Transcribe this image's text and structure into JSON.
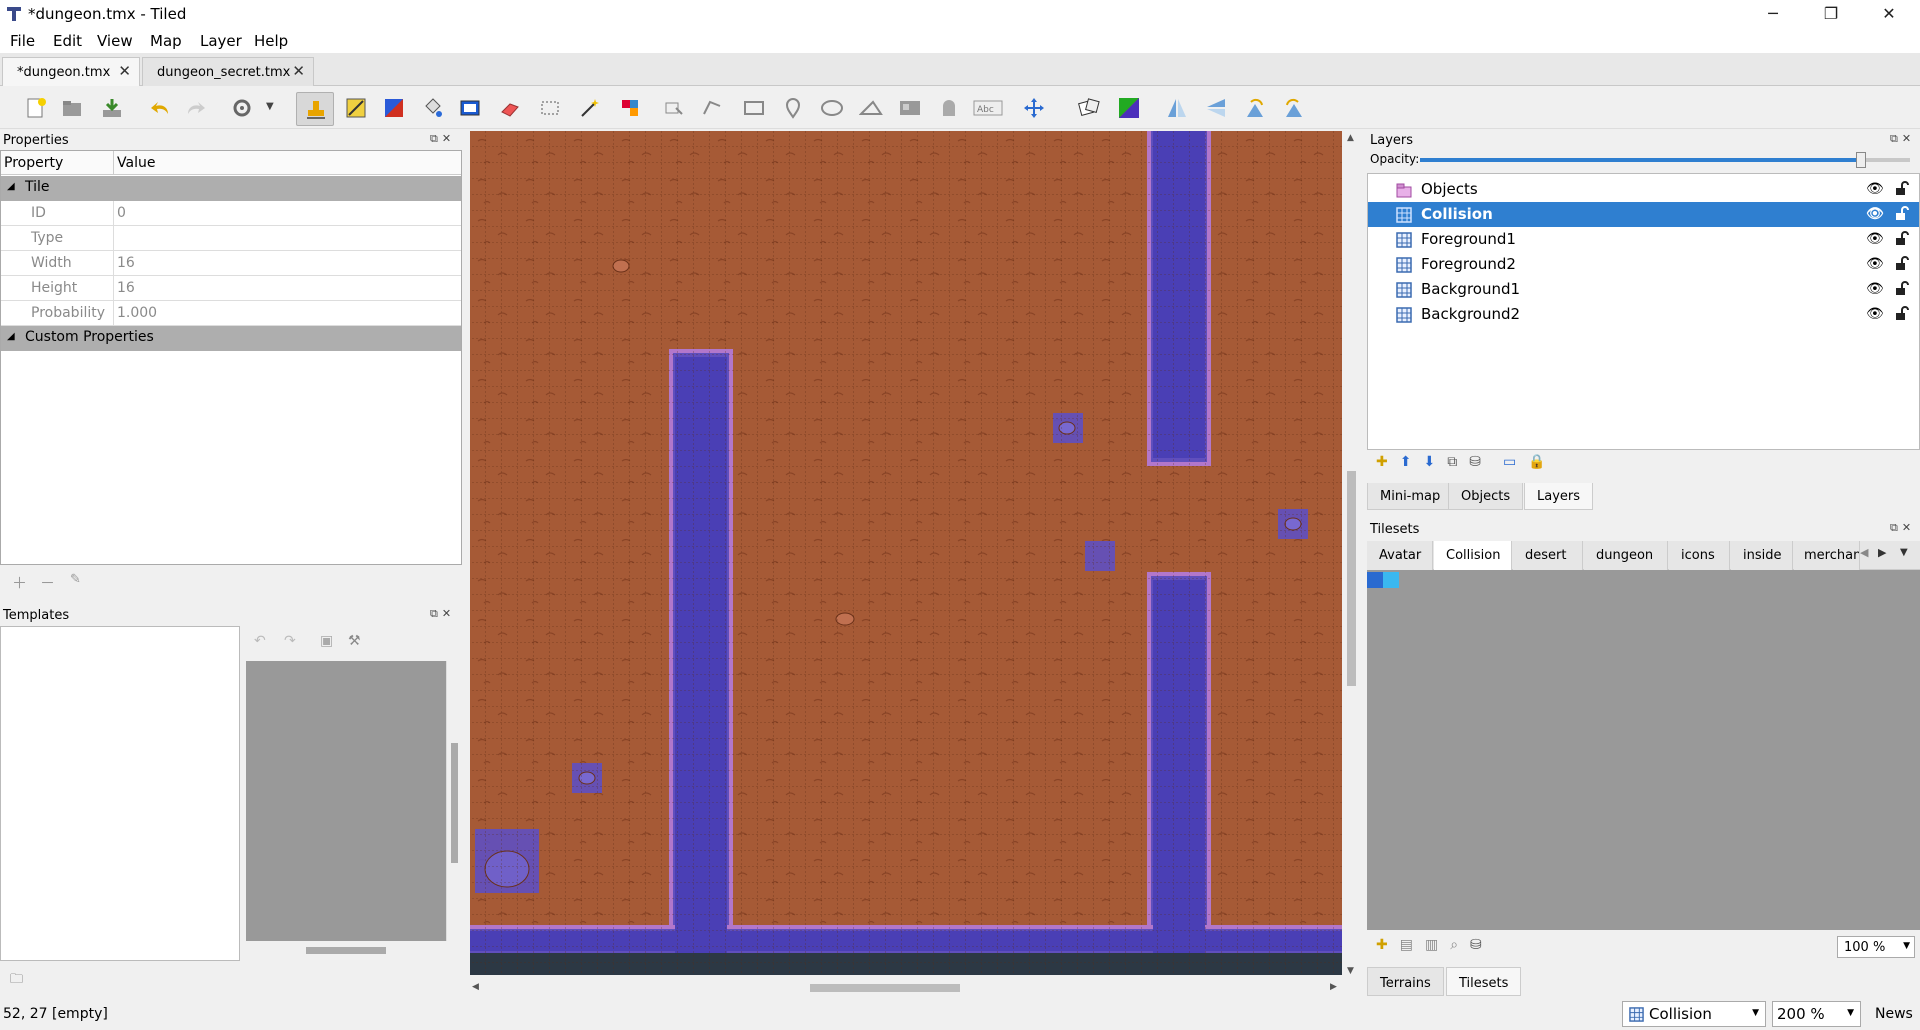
{
  "window": {
    "title": "*dungeon.tmx - Tiled",
    "minimize": "─",
    "maximize": "❐",
    "close": "✕"
  },
  "menu": [
    "File",
    "Edit",
    "View",
    "Map",
    "Layer",
    "Help"
  ],
  "doc_tabs": [
    {
      "label": "*dungeon.tmx",
      "active": true
    },
    {
      "label": "dungeon_secret.tmx",
      "active": false
    }
  ],
  "properties": {
    "title": "Properties",
    "col_property": "Property",
    "col_value": "Value",
    "group_tile": "Tile",
    "rows": [
      {
        "key": "ID",
        "value": "0"
      },
      {
        "key": "Type",
        "value": ""
      },
      {
        "key": "Width",
        "value": "16"
      },
      {
        "key": "Height",
        "value": "16"
      },
      {
        "key": "Probability",
        "value": "1.000"
      }
    ],
    "group_custom": "Custom Properties"
  },
  "templates": {
    "title": "Templates"
  },
  "layers_panel": {
    "title": "Layers",
    "opacity_label": "Opacity:",
    "opacity": 0.9,
    "layers": [
      {
        "name": "Objects",
        "type": "object",
        "selected": false
      },
      {
        "name": "Collision",
        "type": "tile",
        "selected": true
      },
      {
        "name": "Foreground1",
        "type": "tile",
        "selected": false
      },
      {
        "name": "Foreground2",
        "type": "tile",
        "selected": false
      },
      {
        "name": "Background1",
        "type": "tile",
        "selected": false
      },
      {
        "name": "Background2",
        "type": "tile",
        "selected": false
      }
    ],
    "bottom_tabs": [
      {
        "label": "Mini-map",
        "active": false
      },
      {
        "label": "Objects",
        "active": false
      },
      {
        "label": "Layers",
        "active": true
      }
    ]
  },
  "tilesets_panel": {
    "title": "Tilesets",
    "tabs": [
      {
        "label": "Avatar",
        "active": false
      },
      {
        "label": "Collision",
        "active": true
      },
      {
        "label": "desert",
        "active": false
      },
      {
        "label": "dungeon",
        "active": false
      },
      {
        "label": "icons",
        "active": false
      },
      {
        "label": "inside",
        "active": false
      },
      {
        "label": "merchant",
        "active": false
      }
    ],
    "zoom": "100 %",
    "bottom_tabs": [
      {
        "label": "Terrains",
        "active": false
      },
      {
        "label": "Tilesets",
        "active": true
      }
    ]
  },
  "status": {
    "coords": "52, 27 [empty]",
    "layer_combo": "Collision",
    "zoom_combo": "200 %",
    "news": "News"
  },
  "colors": {
    "floor": "#a65a36",
    "collision": "#5b4fc9",
    "collision_border": "#b47ad8",
    "selection": "#2f7fd0"
  }
}
